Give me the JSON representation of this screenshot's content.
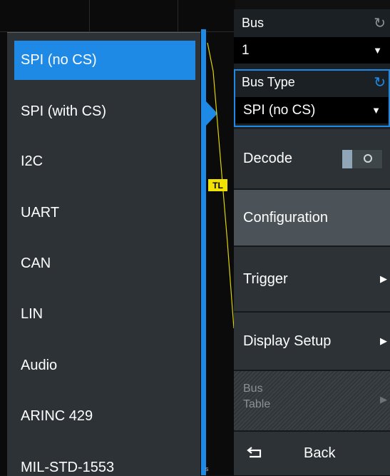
{
  "dropdown": {
    "items": [
      {
        "label": "SPI (no CS)",
        "selected": true
      },
      {
        "label": "SPI (with CS)",
        "selected": false
      },
      {
        "label": "I2C",
        "selected": false
      },
      {
        "label": "UART",
        "selected": false
      },
      {
        "label": "CAN",
        "selected": false
      },
      {
        "label": "LIN",
        "selected": false
      },
      {
        "label": "Audio",
        "selected": false
      },
      {
        "label": "ARINC 429",
        "selected": false
      },
      {
        "label": "MIL-STD-1553",
        "selected": false
      }
    ]
  },
  "waveform": {
    "trigger_level_badge": "TL",
    "marker_text": "s"
  },
  "panel": {
    "bus": {
      "label": "Bus",
      "value": "1"
    },
    "bus_type": {
      "label": "Bus Type",
      "value": "SPI (no CS)"
    },
    "decode": {
      "label": "Decode",
      "state": "off"
    },
    "configuration": {
      "label": "Configuration"
    },
    "trigger": {
      "label": "Trigger"
    },
    "display_setup": {
      "label": "Display Setup"
    },
    "bus_table": {
      "label_line1": "Bus",
      "label_line2": "Table",
      "enabled": false
    },
    "back": {
      "label": "Back"
    }
  },
  "colors": {
    "accent": "#1e8ae6",
    "trigger_badge": "#f2e200",
    "panel_bg": "#1b2024",
    "row_bg": "#2c3236",
    "active_row_bg": "#4b5358"
  },
  "icons": {
    "refresh": "refresh-icon",
    "chevron": "chevron-down-icon",
    "submenu": "submenu-arrow-icon",
    "back": "back-icon"
  }
}
